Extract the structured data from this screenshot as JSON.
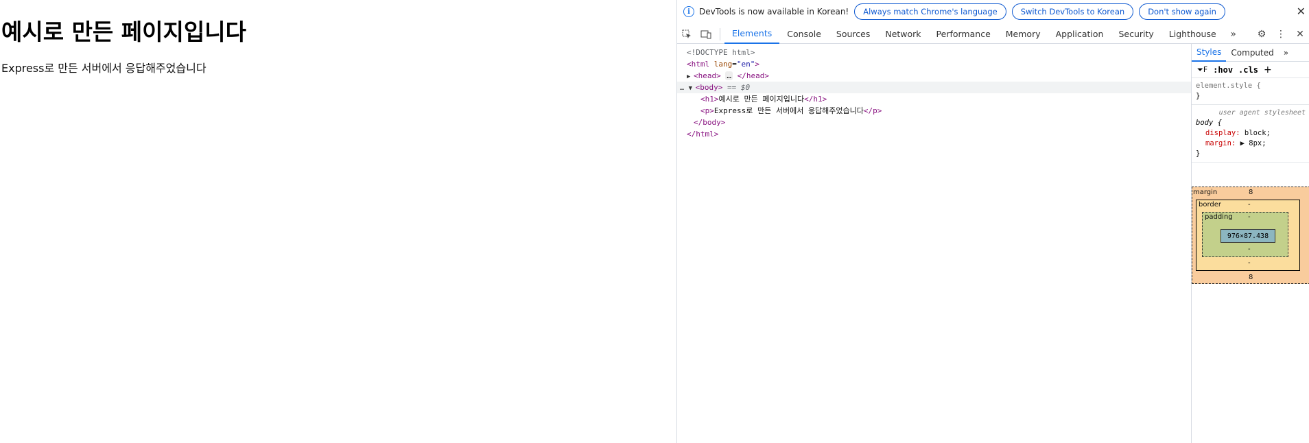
{
  "page": {
    "heading": "예시로 만든 페이지입니다",
    "paragraph": "Express로 만든 서버에서 응답해주었습니다"
  },
  "infobar": {
    "message": "DevTools is now available in Korean!",
    "btn_match": "Always match Chrome's language",
    "btn_switch": "Switch DevTools to Korean",
    "btn_dont_show": "Don't show again"
  },
  "tabs": [
    "Elements",
    "Console",
    "Sources",
    "Network",
    "Performance",
    "Memory",
    "Application",
    "Security",
    "Lighthouse"
  ],
  "dom": {
    "doctype": "<!DOCTYPE html>",
    "html_open_tag": "<html",
    "lang_attr": "lang",
    "lang_val": "\"en\"",
    "close_gt": ">",
    "head_open": "<head>",
    "head_ellipsis": "…",
    "head_close": "</head>",
    "body_open": "<body>",
    "dollar0": "== $0",
    "h1_open": "<h1>",
    "h1_text": "예시로 만든 페이지입니다",
    "h1_close": "</h1>",
    "p_open": "<p>",
    "p_text": "Express로 만든 서버에서 응답해주었습니다",
    "p_close": "</p>",
    "body_close": "</body>",
    "html_close": "</html>"
  },
  "styles": {
    "tab_styles": "Styles",
    "tab_computed": "Computed",
    "filter_f": "F",
    "hov": ":hov",
    "cls": ".cls",
    "element_style": "element.style {",
    "close_brace": "}",
    "ua_label": "user agent stylesheet",
    "body_selector": "body {",
    "prop_display": "display",
    "val_display": "block;",
    "prop_margin": "margin",
    "val_margin": "8px;"
  },
  "box_model": {
    "margin_label": "margin",
    "margin_top": "8",
    "margin_bottom": "8",
    "border_label": "border",
    "border_val": "-",
    "padding_label": "padding",
    "padding_val": "-",
    "content_size": "976×87.438"
  }
}
